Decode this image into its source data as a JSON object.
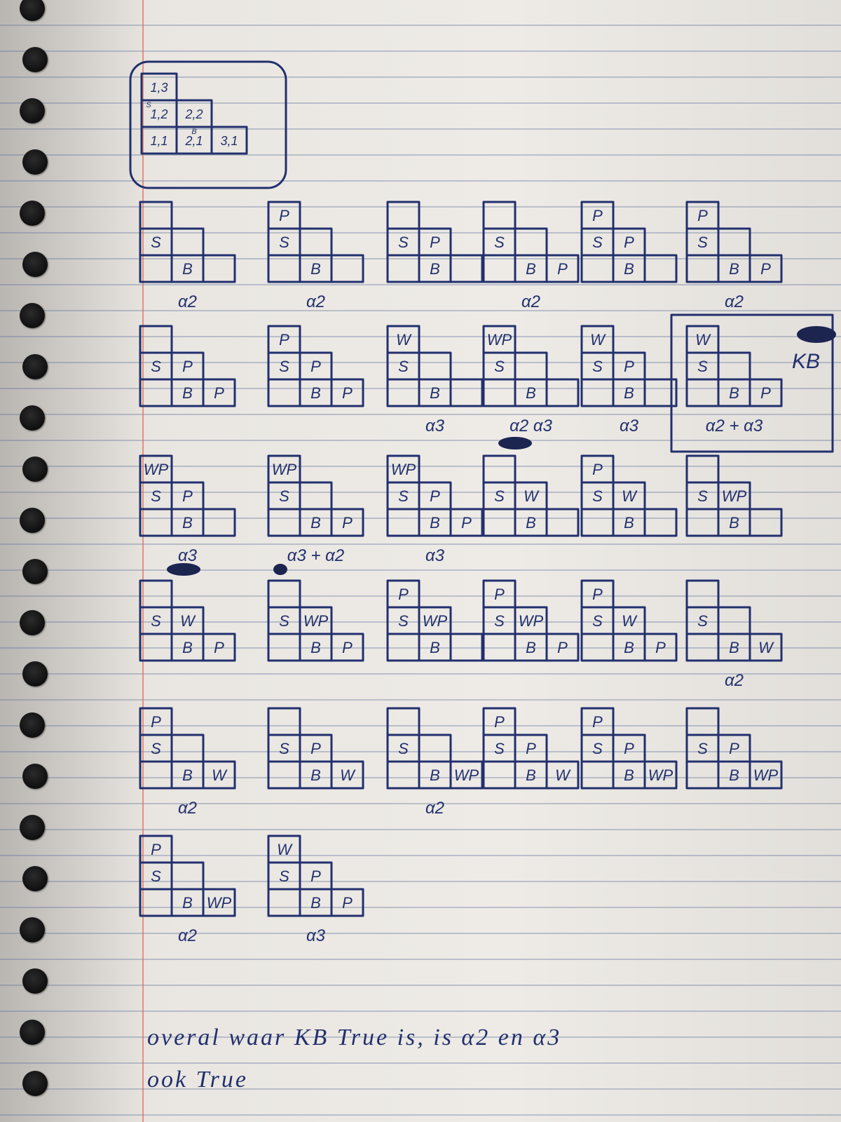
{
  "legend_board": {
    "cells": [
      "1,3",
      "1,2",
      "2,2",
      "1,1",
      "2,1",
      "3,1"
    ],
    "marks": [
      "S",
      "B"
    ]
  },
  "boards": [
    {
      "cells": {
        "s": "S",
        "b": "B"
      },
      "label": "α2"
    },
    {
      "cells": {
        "p": "P",
        "s": "S",
        "b": "B"
      },
      "label": "α2"
    },
    {
      "cells": {
        "s": "S",
        "n": "P",
        "b": "B"
      },
      "label": ""
    },
    {
      "cells": {
        "s": "S",
        "b": "B",
        "e": "P"
      },
      "label": "α2"
    },
    {
      "cells": {
        "p": "P",
        "s": "S",
        "n": "P",
        "b": "B"
      },
      "label": ""
    },
    {
      "cells": {
        "p": "P",
        "s": "S",
        "b": "B",
        "e": "P"
      },
      "label": "α2"
    },
    {
      "cells": {
        "s": "S",
        "n": "P",
        "b": "B",
        "e": "P"
      },
      "label": ""
    },
    {
      "cells": {
        "p": "P",
        "s": "S",
        "n": "P",
        "b": "B",
        "e": "P"
      },
      "label": ""
    },
    {
      "cells": {
        "p": "W",
        "s": "S",
        "b": "B"
      },
      "label": "α3"
    },
    {
      "cells": {
        "p": "WP",
        "s": "S",
        "b": "B"
      },
      "label": "α2 α3"
    },
    {
      "cells": {
        "p": "W",
        "s": "S",
        "n": "P",
        "b": "B"
      },
      "label": "α3"
    },
    {
      "cells": {
        "p": "W",
        "s": "S",
        "b": "B",
        "e": "P"
      },
      "label": "α2 + α3",
      "note": "KB"
    },
    {
      "cells": {
        "p": "WP",
        "s": "S",
        "n": "P",
        "b": "B"
      },
      "label": "α3"
    },
    {
      "cells": {
        "p": "WP",
        "s": "S",
        "b": "B",
        "e": "P"
      },
      "label": "α3 + α2"
    },
    {
      "cells": {
        "p": "WP",
        "s": "S",
        "n": "P",
        "b": "B",
        "e": "P"
      },
      "label": "α3"
    },
    {
      "cells": {
        "s": "S",
        "n": "W",
        "b": "B"
      },
      "label": ""
    },
    {
      "cells": {
        "p": "P",
        "s": "S",
        "n": "W",
        "b": "B"
      },
      "label": ""
    },
    {
      "cells": {
        "s": "S",
        "n": "WP",
        "b": "B"
      },
      "label": ""
    },
    {
      "cells": {
        "s": "S",
        "n": "W",
        "b": "B",
        "e": "P"
      },
      "label": ""
    },
    {
      "cells": {
        "s": "S",
        "n": "WP",
        "b": "B",
        "e": "P"
      },
      "label": ""
    },
    {
      "cells": {
        "p": "P",
        "s": "S",
        "n": "WP",
        "b": "B"
      },
      "label": ""
    },
    {
      "cells": {
        "p": "P",
        "s": "S",
        "n": "WP",
        "b": "B",
        "e": "P"
      },
      "label": ""
    },
    {
      "cells": {
        "p": "P",
        "s": "S",
        "n": "W",
        "b": "B",
        "e": "P"
      },
      "label": ""
    },
    {
      "cells": {
        "s": "S",
        "b": "B",
        "e": "W"
      },
      "label": "α2"
    },
    {
      "cells": {
        "p": "P",
        "s": "S",
        "b": "B",
        "e": "W"
      },
      "label": "α2"
    },
    {
      "cells": {
        "s": "S",
        "n": "P",
        "b": "B",
        "e": "W"
      },
      "label": ""
    },
    {
      "cells": {
        "s": "S",
        "b": "B",
        "e": "WP"
      },
      "label": "α2"
    },
    {
      "cells": {
        "p": "P",
        "s": "S",
        "n": "P",
        "b": "B",
        "e": "W"
      },
      "label": ""
    },
    {
      "cells": {
        "p": "P",
        "s": "S",
        "n": "P",
        "b": "B",
        "e": "WP"
      },
      "label": ""
    },
    {
      "cells": {
        "s": "S",
        "n": "P",
        "b": "B",
        "e": "WP"
      },
      "label": ""
    },
    {
      "cells": {
        "p": "P",
        "s": "S",
        "b": "B",
        "e": "WP"
      },
      "label": "α2"
    },
    {
      "cells": {
        "p": "W",
        "s": "S",
        "n": "P",
        "b": "B",
        "e": "P"
      },
      "label": "α3"
    }
  ],
  "conclusion": {
    "line1": "overal waar KB True is, is α2 en α3",
    "line2": "ook True"
  }
}
